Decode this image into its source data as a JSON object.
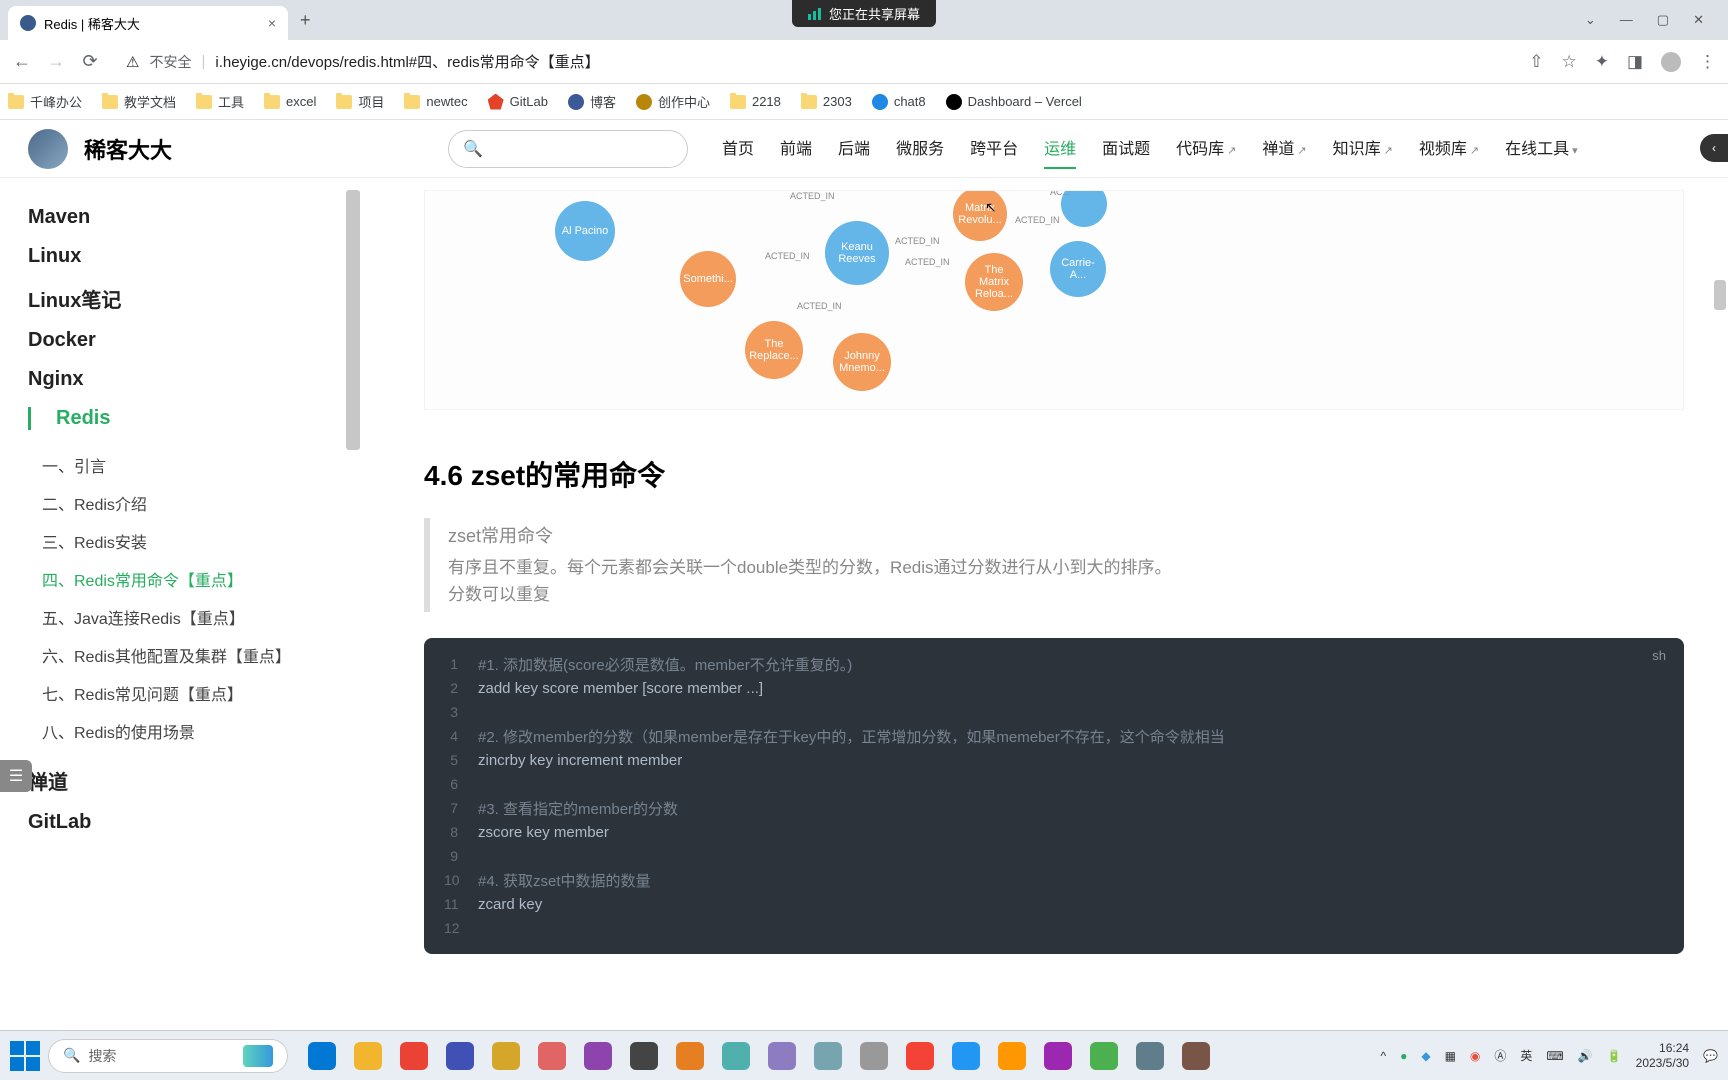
{
  "browser": {
    "tab_title": "Redis | 稀客大大",
    "url": "i.heyige.cn/devops/redis.html#四、redis常用命令【重点】",
    "insecure_label": "不安全",
    "share_banner": "您正在共享屏幕",
    "bookmarks": [
      {
        "label": "千峰办公",
        "type": "folder"
      },
      {
        "label": "教学文档",
        "type": "folder"
      },
      {
        "label": "工具",
        "type": "folder"
      },
      {
        "label": "excel",
        "type": "folder"
      },
      {
        "label": "项目",
        "type": "folder"
      },
      {
        "label": "newtec",
        "type": "folder"
      },
      {
        "label": "GitLab",
        "type": "gitlab"
      },
      {
        "label": "博客",
        "type": "round",
        "color": "#3b5998"
      },
      {
        "label": "创作中心",
        "type": "round",
        "color": "#b8860b"
      },
      {
        "label": "2218",
        "type": "folder"
      },
      {
        "label": "2303",
        "type": "folder"
      },
      {
        "label": "chat8",
        "type": "round",
        "color": "#1e88e5"
      },
      {
        "label": "Dashboard – Vercel",
        "type": "round",
        "color": "#000"
      }
    ]
  },
  "site": {
    "title": "稀客大大",
    "nav": [
      {
        "label": "首页"
      },
      {
        "label": "前端"
      },
      {
        "label": "后端"
      },
      {
        "label": "微服务"
      },
      {
        "label": "跨平台"
      },
      {
        "label": "运维",
        "active": true
      },
      {
        "label": "面试题"
      },
      {
        "label": "代码库",
        "ext": true
      },
      {
        "label": "禅道",
        "ext": true
      },
      {
        "label": "知识库",
        "ext": true
      },
      {
        "label": "视频库",
        "ext": true
      },
      {
        "label": "在线工具",
        "dropdown": true
      }
    ]
  },
  "sidebar": {
    "sections": [
      {
        "label": "Maven"
      },
      {
        "label": "Linux"
      },
      {
        "label": "Linux笔记"
      },
      {
        "label": "Docker"
      },
      {
        "label": "Nginx"
      },
      {
        "label": "Redis",
        "active": true,
        "children": [
          {
            "label": "一、引言"
          },
          {
            "label": "二、Redis介绍"
          },
          {
            "label": "三、Redis安装"
          },
          {
            "label": "四、Redis常用命令【重点】",
            "active": true
          },
          {
            "label": "五、Java连接Redis【重点】"
          },
          {
            "label": "六、Redis其他配置及集群【重点】"
          },
          {
            "label": "七、Redis常见问题【重点】"
          },
          {
            "label": "八、Redis的使用场景"
          }
        ]
      },
      {
        "label": "禅道"
      },
      {
        "label": "GitLab"
      }
    ]
  },
  "content": {
    "graph_nodes": {
      "pacino": "Al Pacino",
      "keanu": "Keanu Reeves",
      "johnny": "Johnny Mnemo...",
      "replace": "The Replace...",
      "somethi": "Somethi...",
      "reload": "The Matrix Reloa...",
      "revo": "Matrix Revolu...",
      "carrie": "Carrie-A..."
    },
    "graph_edge": "ACTED_IN",
    "heading": "4.6 zset的常用命令",
    "quote": {
      "title": "zset常用命令",
      "line1": "有序且不重复。每个元素都会关联一个double类型的分数，Redis通过分数进行从小到大的排序。",
      "line2": "分数可以重复"
    },
    "code": {
      "lang": "sh",
      "lines": [
        {
          "n": 1,
          "c": "comment",
          "t": "#1. 添加数据(score必须是数值。member不允许重复的。)"
        },
        {
          "n": 2,
          "c": "cmd",
          "t": "zadd key score member [score member ...]"
        },
        {
          "n": 3,
          "c": "",
          "t": ""
        },
        {
          "n": 4,
          "c": "comment",
          "t": "#2. 修改member的分数（如果member是存在于key中的，正常增加分数，如果memeber不存在，这个命令就相当"
        },
        {
          "n": 5,
          "c": "cmd",
          "t": "zincrby key increment member"
        },
        {
          "n": 6,
          "c": "",
          "t": ""
        },
        {
          "n": 7,
          "c": "comment",
          "t": "#3. 查看指定的member的分数"
        },
        {
          "n": 8,
          "c": "cmd",
          "t": "zscore key member"
        },
        {
          "n": 9,
          "c": "",
          "t": ""
        },
        {
          "n": 10,
          "c": "comment",
          "t": "#4. 获取zset中数据的数量"
        },
        {
          "n": 11,
          "c": "cmd",
          "t": "zcard key"
        },
        {
          "n": 12,
          "c": "",
          "t": ""
        }
      ]
    }
  },
  "taskbar": {
    "search_placeholder": "搜索",
    "ime": "英",
    "time": "16:24",
    "date": "2023/5/30",
    "app_colors": [
      "#0078d4",
      "#f1b62e",
      "#ea4335",
      "#3f51b5",
      "#d4a62a",
      "#e06666",
      "#8e44ad",
      "#444",
      "#e67e22",
      "#4fb0ae",
      "#8e7cc3",
      "#76a5af",
      "#999",
      "#f44336",
      "#2196f3",
      "#ff9800",
      "#9c27b0",
      "#4caf50",
      "#607d8b",
      "#795548"
    ]
  }
}
